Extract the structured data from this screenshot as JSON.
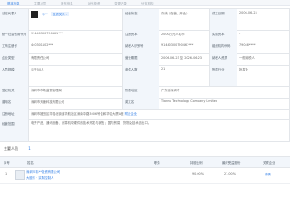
{
  "tabs": [
    "基本信息",
    "主要人员",
    "股东信息",
    "对外投资",
    "变更记录",
    "分支机构"
  ],
  "basic": {
    "legal_rep_label": "法定代表人",
    "legal_rep_name": "韦**",
    "legal_rep_tag": "投资关系 ›",
    "status_label": "经营状态",
    "status_value": "存续（在营、开业）",
    "established_label": "成立日期",
    "established_value": "2006-06-23",
    "reg_capital_label": "注册资本",
    "reg_capital_value": "2000万元人民币",
    "paid_capital_label": "实缴资本",
    "paid_capital_value": "-",
    "credit_code_label": "统一社会信用代码",
    "credit_code_value": "91440300790461***",
    "taxpayer_id_label": "纳税人识别号",
    "taxpayer_id_value": "91440300790461***",
    "reg_number_label": "工商注册号",
    "reg_number_value": "440301102***",
    "org_code_label": "组织机构代码",
    "org_code_value": "79046****",
    "company_type_label": "企业类型",
    "company_type_value": "有限责任公司",
    "business_term_label": "营业期限",
    "business_term_value": "2006-06-23 至 2026-06-23",
    "taxpayer_qual_label": "纳税人资质",
    "taxpayer_qual_value": "一般纳税人",
    "staff_label": "人员规模",
    "staff_value": "少于50人",
    "insured_label": "参保人数",
    "insured_value": "21",
    "industry_label": "所属行业",
    "industry_value": "批发业",
    "reg_authority_label": "登记机关",
    "reg_authority_value": "深圳市市场监督管理局",
    "region_label": "所属地区",
    "region_value": "广东省深圳市",
    "en_name_label": "英文名",
    "en_name_value": "Tiansu Technology Company Limited",
    "former_name_label": "曾用名",
    "former_name_value": "深圳市天速科技有限公司",
    "address_label": "注册地址",
    "address_value": "深圳市福田区华强北街道华航社区深南中路3006号佳和华强大厦A座",
    "address_link": "附近企业",
    "scope_label": "经营范围",
    "scope_value": "电子产品、通讯设备、计算机软硬件的技术开发与销售；国内贸易；货物及技术进出口。"
  },
  "bottom": {
    "title": "主要人员",
    "count": "1",
    "columns": [
      "序号",
      "姓名",
      "职务",
      "持股比例",
      "最终受益股份",
      "关联企业"
    ],
    "rows": [
      {
        "index": "1",
        "name": "深圳市韦**投资有限公司",
        "sub": "大股东 · 实际控制人",
        "duty": "",
        "share": "90.00%",
        "final_share": "27.00%",
        "related": "详情"
      }
    ]
  }
}
